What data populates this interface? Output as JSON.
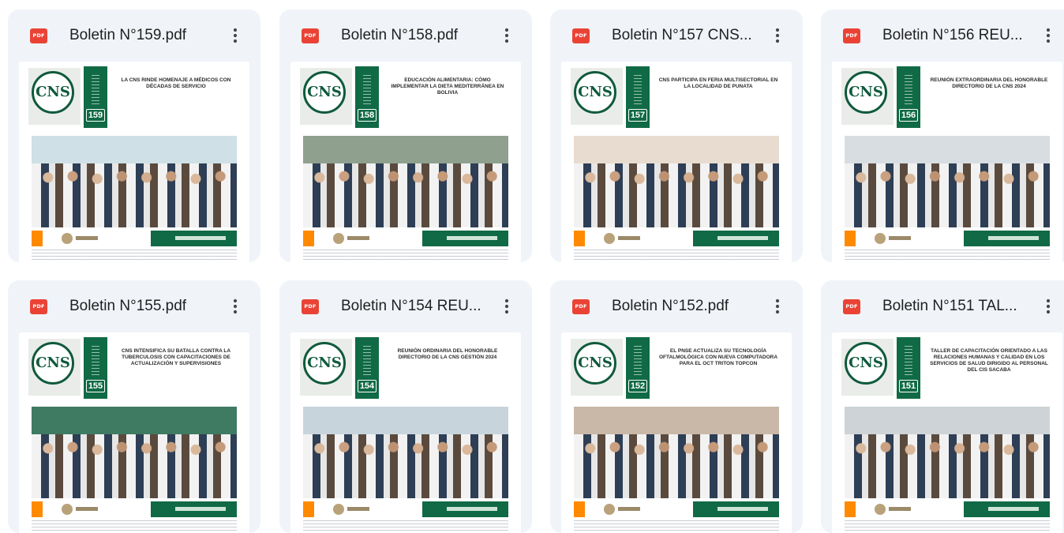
{
  "files": [
    {
      "name": "Boletin N°159.pdf",
      "issue": "159",
      "headline": "LA CNS RINDE HOMENAJE A MÉDICOS CON DÉCADAS DE SERVICIO",
      "file_type": "PDF",
      "scene": "lab"
    },
    {
      "name": "Boletin N°158.pdf",
      "issue": "158",
      "headline": "EDUCACIÓN ALIMENTARIA: CÓMO IMPLEMENTAR LA DIETA MEDITERRÁNEA EN BOLIVIA",
      "file_type": "PDF",
      "scene": "audience"
    },
    {
      "name": "Boletin N°157 CNS...",
      "issue": "157",
      "headline": "CNS PARTICIPA EN FERIA MULTISECTORIAL EN LA LOCALIDAD DE PUNATA",
      "file_type": "PDF",
      "scene": "group"
    },
    {
      "name": "Boletin N°156 REU...",
      "issue": "156",
      "headline": "REUNIÓN EXTRAORDINARIA DEL HONORABLE DIRECTORIO DE LA CNS 2024",
      "file_type": "PDF",
      "scene": "hall"
    },
    {
      "name": "Boletin N°155.pdf",
      "issue": "155",
      "headline": "CNS INTENSIFICA SU BATALLA CONTRA LA TUBERCULOSIS CON CAPACITACIONES DE ACTUALIZACIÓN Y SUPERVISIONES",
      "file_type": "PDF",
      "scene": "green"
    },
    {
      "name": "Boletin N°154 REU...",
      "issue": "154",
      "headline": "REUNIÓN ORDINARIA DEL HONORABLE DIRECTORIO DE LA CNS GESTIÓN 2024",
      "file_type": "PDF",
      "scene": "table"
    },
    {
      "name": "Boletin N°152.pdf",
      "issue": "152",
      "headline": "EL PNSE ACTUALIZA SU TECNOLOGÍA OFTALMOLÓGICA CON NUEVA COMPUTADORA PARA EL OCT TRITON TOPCON",
      "file_type": "PDF",
      "scene": "clinic"
    },
    {
      "name": "Boletin N°151 TAL...",
      "issue": "151",
      "headline": "TALLER DE CAPACITACIÓN ORIENTADO A LAS RELACIONES HUMANAS Y CALIDAD EN LOS SERVICIOS DE SALUD DIRIGIDO AL PERSONAL DEL CIS SACABA",
      "file_type": "PDF",
      "scene": "classroom"
    }
  ],
  "logo_text": "CNS",
  "colors": {
    "card_bg": "#f0f4f9",
    "pdf_red": "#ea4335",
    "cns_green": "#106a45",
    "accent_orange": "#ff8a00"
  },
  "icons": {
    "file": "pdf-icon",
    "menu": "more-vert-icon"
  }
}
